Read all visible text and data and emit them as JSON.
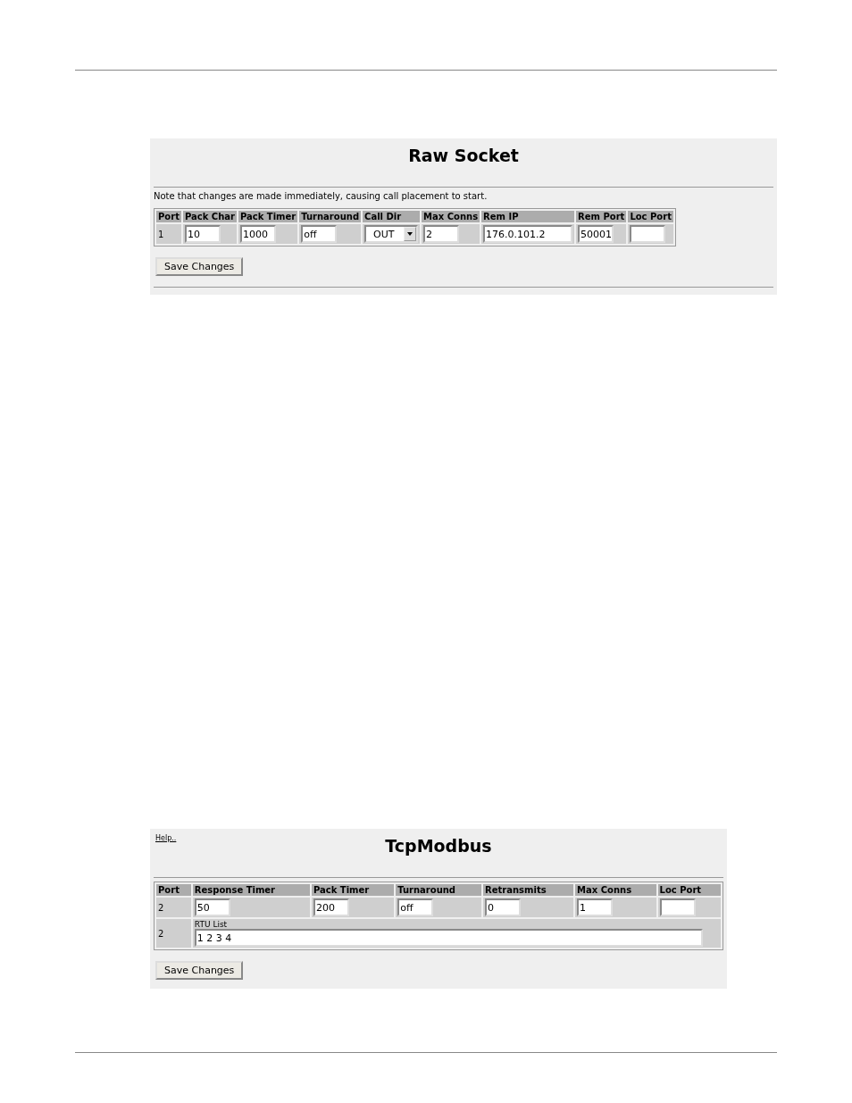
{
  "panels": [
    {
      "title": "Raw Socket",
      "note": "Note that changes are made immediately, causing call placement to start.",
      "columns": [
        "Port",
        "Pack Char",
        "Pack Timer",
        "Turnaround",
        "Call Dir",
        "Max Conns",
        "Rem IP",
        "Rem Port",
        "Loc Port"
      ],
      "rows": [
        [
          {
            "kind": "text",
            "value": "1"
          },
          {
            "kind": "input",
            "value": "10"
          },
          {
            "kind": "input",
            "value": "1000"
          },
          {
            "kind": "input",
            "value": "off"
          },
          {
            "kind": "select",
            "value": "OUT"
          },
          {
            "kind": "input",
            "value": "2"
          },
          {
            "kind": "input",
            "value": "176.0.101.2"
          },
          {
            "kind": "input",
            "value": "50001"
          },
          {
            "kind": "input"
          }
        ]
      ],
      "button": "Save Changes",
      "bottom_rule": true
    },
    {
      "help": "Help..",
      "title": "TcpModbus",
      "columns": [
        "Port",
        "Response Timer",
        "Pack Timer",
        "Turnaround",
        "Retransmits",
        "Max Conns",
        "Loc Port"
      ],
      "rows": [
        [
          {
            "kind": "text",
            "value": "2"
          },
          {
            "kind": "input",
            "value": "50"
          },
          {
            "kind": "input",
            "value": "200"
          },
          {
            "kind": "input",
            "value": "off"
          },
          {
            "kind": "input",
            "value": "0"
          },
          {
            "kind": "input",
            "value": "1"
          },
          {
            "kind": "input"
          }
        ],
        [
          {
            "kind": "text",
            "value": "2"
          },
          {
            "kind": "wide",
            "colspan": 6,
            "label": "RTU List",
            "value": "1 2 3 4"
          }
        ]
      ],
      "button": "Save Changes",
      "bottom_rule": false
    }
  ]
}
